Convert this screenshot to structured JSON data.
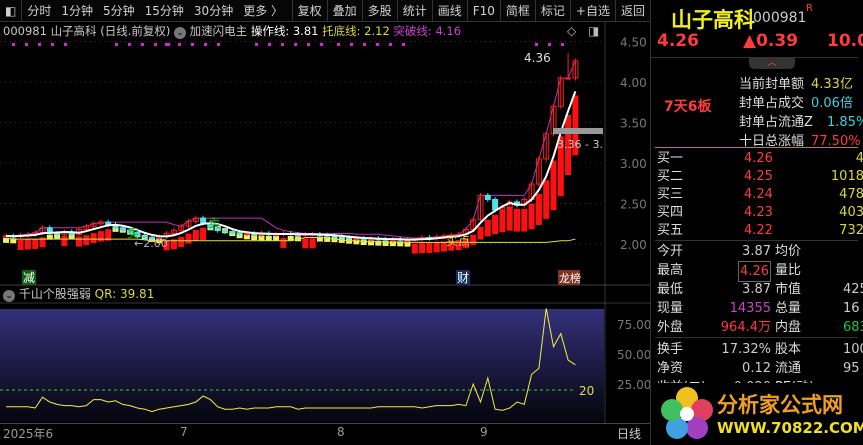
{
  "toolbar": {
    "items": [
      "分时",
      "1分钟",
      "5分钟",
      "15分钟",
      "30分钟",
      "更多 〉"
    ],
    "buttons": [
      "复权",
      "叠加",
      "多股",
      "统计",
      "画线",
      "F10",
      "简框",
      "标记",
      "+自选",
      "返回"
    ]
  },
  "info": {
    "code": "000981",
    "name": "山子高科",
    "mode": "(日线.前复权)",
    "indicator": "加速闪电主",
    "op_label": "操作线:",
    "op_value": "3.81",
    "base_label": "托底线:",
    "base_value": "2.12",
    "break_label": "突破线:",
    "break_value": "4.16"
  },
  "chart_labels": {
    "high_marker": "4.36",
    "low_marker": "←2.00",
    "range_label": "3.36 - 3.",
    "sell1": "卖",
    "sell2": "卖",
    "buy": "买点",
    "jian": "减",
    "cai": "财",
    "bang": "龙榜"
  },
  "price_axis": [
    "4.50",
    "4.00",
    "3.50",
    "3.00",
    "2.50",
    "2.00"
  ],
  "indicator": {
    "name": "千山个股强弱",
    "qr_label": "QR:",
    "qr_value": "39.81",
    "axis": [
      "75.00",
      "50.00",
      "25.00"
    ],
    "threshold": "20"
  },
  "dates": {
    "labels": [
      "2025年6",
      "7",
      "8",
      "9"
    ],
    "period": "日线"
  },
  "colors": {
    "up": "#ff2020",
    "down": "#50e0f0",
    "ma": "#ffffff",
    "pressure": "#c030c0",
    "support": "#e0e040"
  },
  "chart_data": {
    "type": "candlestick",
    "closes": [
      2.1,
      2.09,
      2.11,
      2.12,
      2.14,
      2.2,
      2.13,
      2.12,
      2.15,
      2.12,
      2.18,
      2.22,
      2.25,
      2.27,
      2.24,
      2.2,
      2.17,
      2.14,
      2.1,
      2.08,
      2.07,
      2.09,
      2.13,
      2.17,
      2.22,
      2.28,
      2.32,
      2.26,
      2.2,
      2.17,
      2.15,
      2.14,
      2.13,
      2.13,
      2.12,
      2.13,
      2.12,
      2.12,
      2.13,
      2.12,
      2.11,
      2.12,
      2.12,
      2.11,
      2.1,
      2.09,
      2.08,
      2.07,
      2.07,
      2.06,
      2.07,
      2.06,
      2.05,
      2.06,
      2.05,
      2.05,
      2.06,
      2.08,
      2.07,
      2.09,
      2.1,
      2.11,
      2.12,
      2.18,
      2.3,
      2.6,
      2.55,
      2.42,
      2.45,
      2.52,
      2.48,
      2.55,
      2.74,
      3.05,
      3.36,
      3.7,
      4.05,
      4.05,
      4.26
    ],
    "qr": [
      6,
      6,
      6,
      6,
      5,
      14,
      10,
      8,
      7,
      7,
      6,
      7,
      12,
      12,
      10,
      11,
      8,
      7,
      5,
      4,
      2,
      4,
      5,
      6,
      7,
      8,
      10,
      15,
      12,
      6,
      4,
      4,
      5,
      4,
      5,
      5,
      5,
      6,
      6,
      6,
      4,
      5,
      5,
      5,
      5,
      5,
      5,
      5,
      5,
      5,
      5,
      6,
      6,
      6,
      6,
      6,
      6,
      5,
      6,
      7,
      7,
      7,
      8,
      7,
      25,
      10,
      30,
      4,
      3,
      5,
      10,
      8,
      33,
      38,
      88,
      56,
      67,
      45,
      41
    ],
    "ylim": [
      1.9,
      4.6
    ],
    "qr_ylim": [
      0,
      100
    ],
    "high": 4.36,
    "low": 2.0
  },
  "panel": {
    "name": "山子高科",
    "code": "000981",
    "r_mark": "R",
    "price": "4.26",
    "change": "▲0.39",
    "pct": "10.0",
    "streak": "7天6板",
    "seal": [
      {
        "label": "当前封单额",
        "value": "4.33亿"
      },
      {
        "label": "封单占成交",
        "value": "0.06倍"
      },
      {
        "label": "封单占流通Z",
        "value": "1.85%"
      },
      {
        "label": "十日总涨幅",
        "value": "77.50%"
      }
    ],
    "book": [
      {
        "label": "买一",
        "price": "4.26",
        "vol": "4"
      },
      {
        "label": "买二",
        "price": "4.25",
        "vol": "1018"
      },
      {
        "label": "买三",
        "price": "4.24",
        "vol": "478"
      },
      {
        "label": "买四",
        "price": "4.23",
        "vol": "403"
      },
      {
        "label": "买五",
        "price": "4.22",
        "vol": "732"
      }
    ],
    "stats": [
      {
        "l1": "今开",
        "v1": "3.87",
        "l2": "均价",
        "v2": ""
      },
      {
        "l1": "最高",
        "v1": "4.26",
        "l2": "量比",
        "v2": ""
      },
      {
        "l1": "最低",
        "v1": "3.87",
        "l2": "市值",
        "v2": "425"
      },
      {
        "l1": "现量",
        "v1": "14355",
        "l2": "总量",
        "v2": "16"
      },
      {
        "l1": "外盘",
        "v1": "964.4万",
        "l2": "内盘",
        "v2": "683"
      }
    ],
    "stats2": [
      {
        "l1": "换手",
        "v1": "17.32%",
        "l2": "股本",
        "v2": "100"
      },
      {
        "l1": "净资",
        "v1": "0.12",
        "l2": "流通",
        "v2": "95"
      },
      {
        "l1": "收益(二)",
        "v1": "0.020",
        "l2": "PE(动)",
        "v2": ""
      }
    ],
    "watermark": {
      "title": "分析家公式网",
      "url": "WWW.70822.COM"
    }
  }
}
